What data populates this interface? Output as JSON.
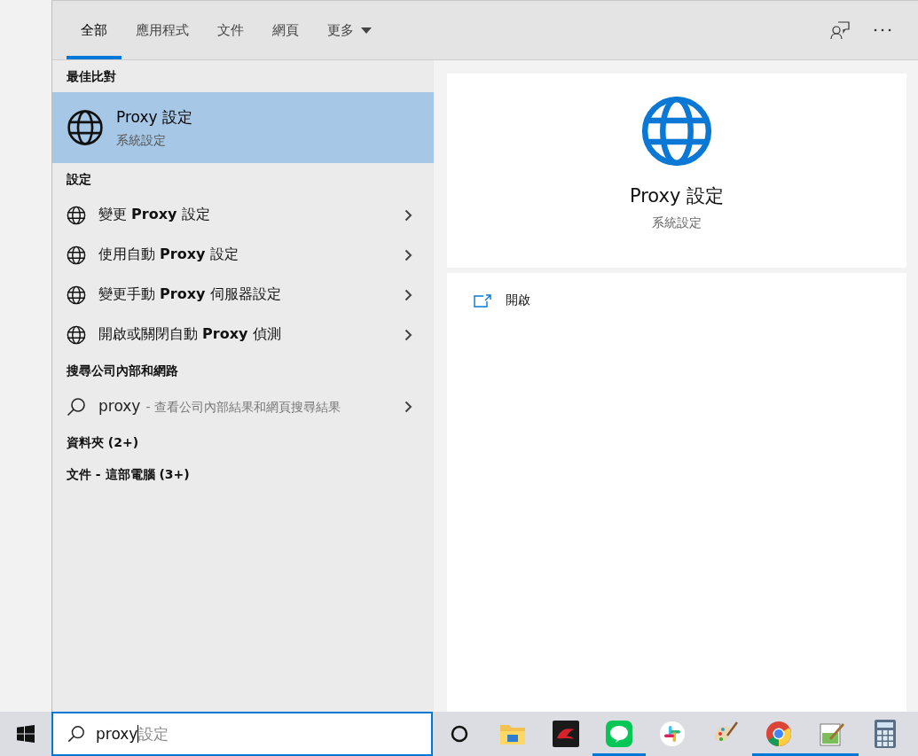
{
  "tabs": [
    {
      "label": "全部",
      "selected": true
    },
    {
      "label": "應用程式",
      "selected": false
    },
    {
      "label": "文件",
      "selected": false
    },
    {
      "label": "網頁",
      "selected": false
    },
    {
      "label": "更多",
      "selected": false,
      "kind": "dropdown"
    }
  ],
  "best_match": {
    "heading": "最佳比對",
    "title": "Proxy 設定",
    "subtitle": "系統設定",
    "selected": true
  },
  "sections": [
    {
      "heading": "設定",
      "items": [
        {
          "kind": "setting",
          "text": "變更 **Proxy** 設定"
        },
        {
          "kind": "setting",
          "text": "使用自動 **Proxy** 設定"
        },
        {
          "kind": "setting",
          "text": "變更手動 **Proxy** 伺服器設定"
        },
        {
          "kind": "setting",
          "text": "開啟或關閉自動 **Proxy** 偵測"
        }
      ]
    },
    {
      "heading": "搜尋公司內部和網路",
      "items": [
        {
          "kind": "web",
          "text": "proxy",
          "detail": "- 查看公司內部結果和網頁搜尋結果"
        }
      ]
    },
    {
      "heading": "資料夾 (2+)"
    },
    {
      "heading": "文件 - 這部電腦 (3+)"
    }
  ],
  "preview": {
    "title": "Proxy 設定",
    "subtitle": "系統設定",
    "actions": [
      {
        "label": "開啟"
      }
    ]
  },
  "search": {
    "value": "proxy",
    "completion": "設定"
  },
  "taskbar": {
    "apps": [
      {
        "kind": "folder",
        "running": false
      },
      {
        "kind": "dragon",
        "running": false
      },
      {
        "kind": "chat",
        "running": true
      },
      {
        "kind": "slack",
        "running": false
      },
      {
        "kind": "palette",
        "running": false
      },
      {
        "kind": "chrome",
        "running": true
      },
      {
        "kind": "notepad",
        "running": true
      },
      {
        "kind": "calculator",
        "running": false
      }
    ]
  }
}
